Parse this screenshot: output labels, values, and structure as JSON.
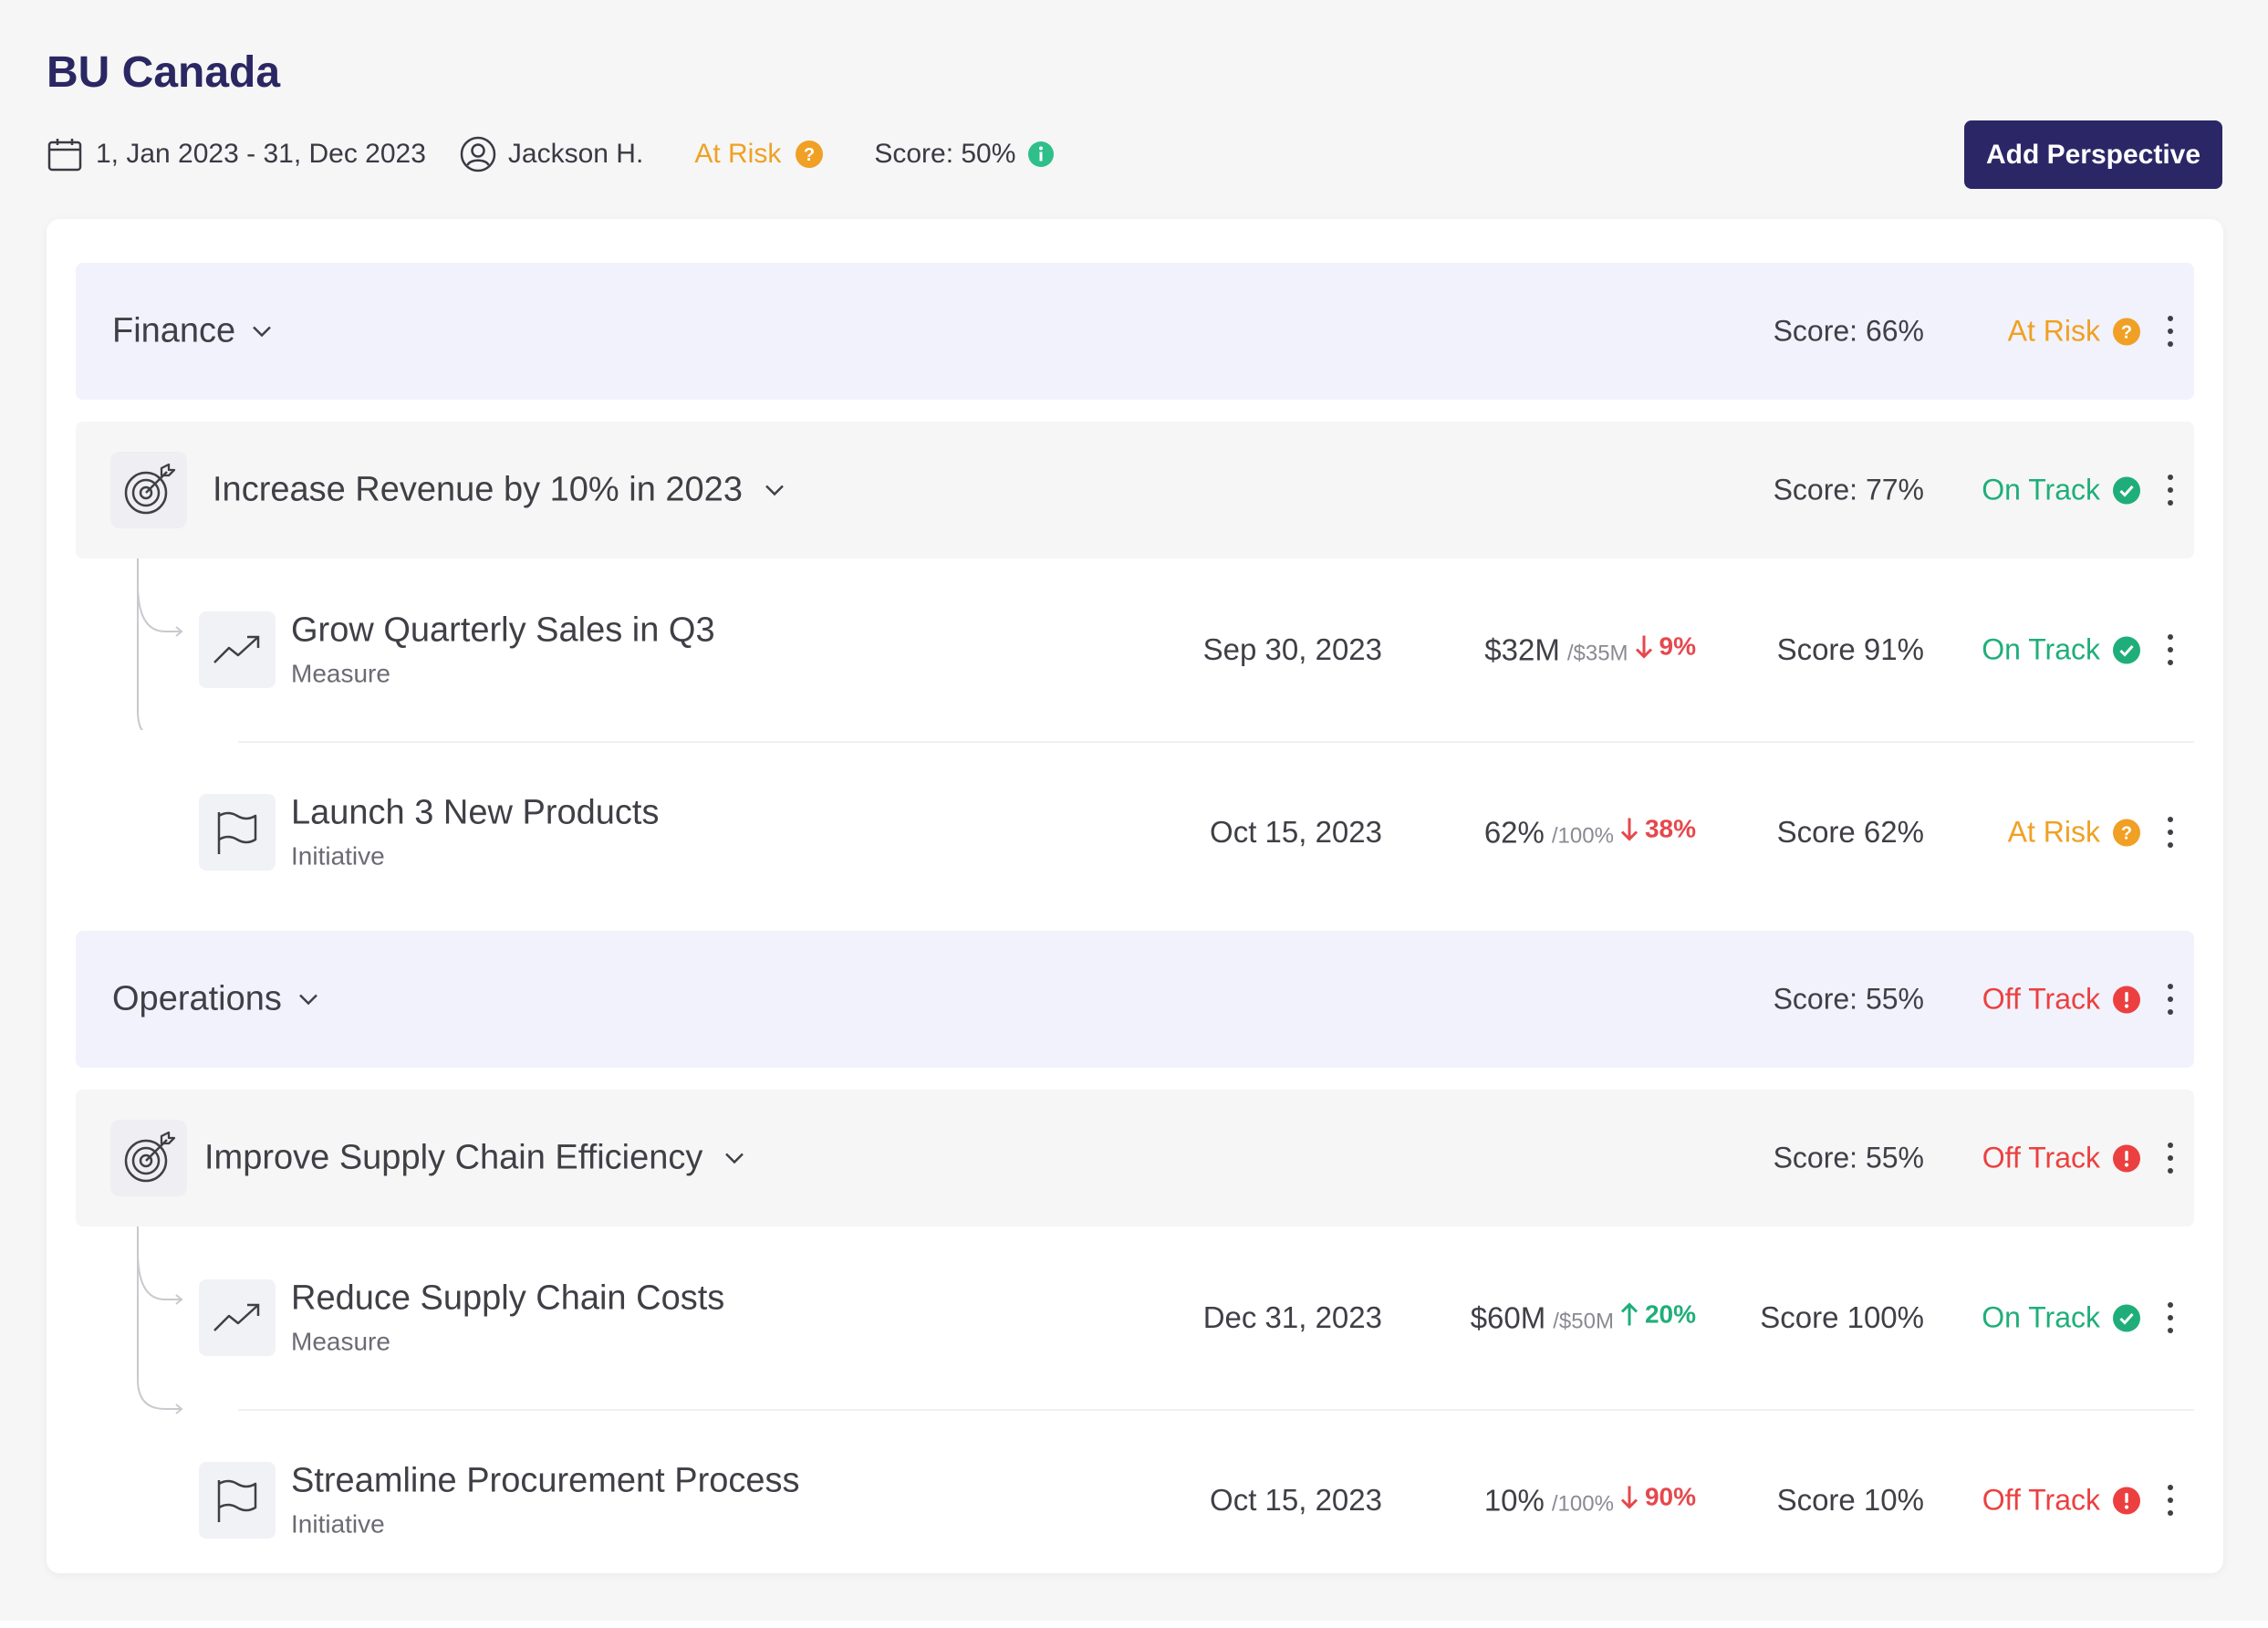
{
  "header": {
    "title": "BU Canada",
    "date_range": "1, Jan 2023 - 31, Dec 2023",
    "owner": "Jackson H.",
    "status": "At Risk",
    "score": "Score: 50%",
    "add_button": "Add Perspective"
  },
  "perspectives": [
    {
      "name": "Finance",
      "score": "Score: 66%",
      "status": "At Risk",
      "objective": {
        "name": "Increase Revenue by 10% in 2023",
        "score": "Score: 77%",
        "status": "On Track",
        "items": [
          {
            "name": "Grow Quarterly Sales in Q3",
            "type": "Measure",
            "date": "Sep 30, 2023",
            "value": "$32M",
            "target": "/$35M",
            "delta": "9%",
            "delta_direction": "down",
            "score": "Score 91%",
            "status": "On Track"
          },
          {
            "name": "Launch 3 New Products",
            "type": "Initiative",
            "date": "Oct 15, 2023",
            "value": "62%",
            "target": "/100%",
            "delta": "38%",
            "delta_direction": "down",
            "score": "Score 62%",
            "status": "At Risk"
          }
        ]
      }
    },
    {
      "name": "Operations",
      "score": "Score: 55%",
      "status": "Off Track",
      "objective": {
        "name": "Improve Supply Chain Efficiency",
        "score": "Score: 55%",
        "status": "Off Track",
        "items": [
          {
            "name": "Reduce Supply Chain Costs",
            "type": "Measure",
            "date": "Dec 31, 2023",
            "value": "$60M",
            "target": "/$50M",
            "delta": "20%",
            "delta_direction": "up",
            "score": "Score 100%",
            "status": "On Track"
          },
          {
            "name": "Streamline Procurement Process",
            "type": "Initiative",
            "date": "Oct 15, 2023",
            "value": "10%",
            "target": "/100%",
            "delta": "90%",
            "delta_direction": "down",
            "score": "Score 10%",
            "status": "Off Track"
          }
        ]
      }
    }
  ],
  "icons": {
    "calendar": "calendar-icon",
    "user": "user-circle-icon",
    "help": "question-badge-icon",
    "info": "info-badge-icon",
    "chevron": "chevron-down-icon",
    "target": "target-arrow-icon",
    "trend": "trending-up-icon",
    "flag": "flag-icon",
    "check": "check-badge-icon",
    "alert": "alert-badge-icon",
    "more": "kebab-menu-icon"
  },
  "colors": {
    "brand": "#2b2767",
    "at_risk": "#f0a024",
    "on_track": "#1fae7a",
    "off_track": "#ec4040",
    "info": "#2fbf8a",
    "perspective_bg": "#f1f2fb",
    "objective_bg": "#f6f6f6"
  }
}
